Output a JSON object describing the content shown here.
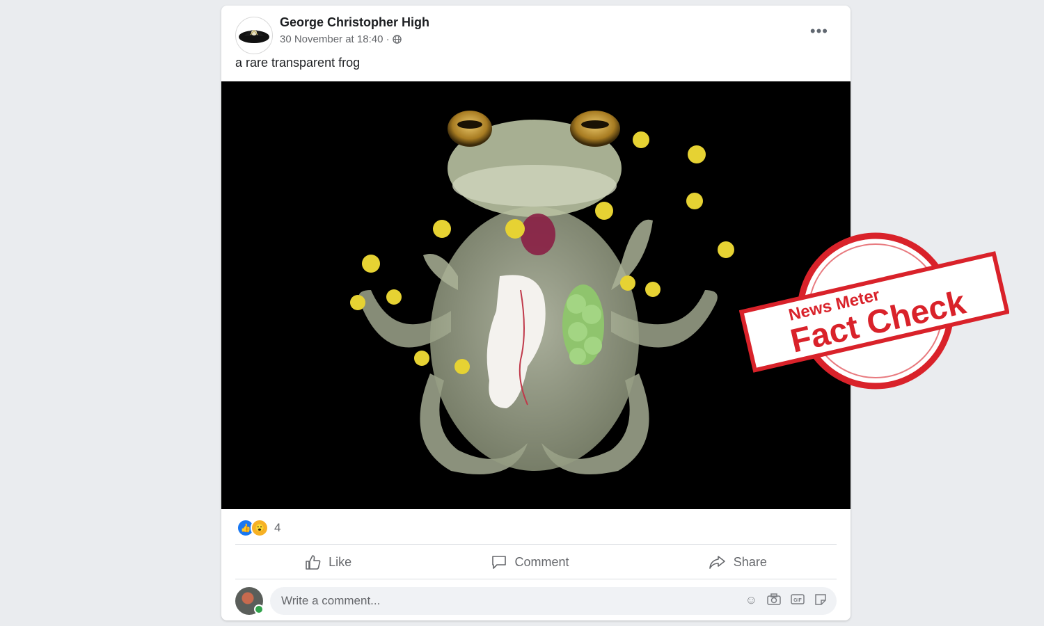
{
  "post": {
    "author": "George Christopher High",
    "timestamp": "30 November at 18:40 ·",
    "privacy_icon": "globe-icon",
    "menu_label": "•••",
    "caption": "a rare transparent frog"
  },
  "reactions": {
    "icons": [
      "like-reaction-icon",
      "wow-reaction-icon"
    ],
    "count": "4"
  },
  "actions": {
    "like": "Like",
    "comment": "Comment",
    "share": "Share"
  },
  "comment_composer": {
    "placeholder": "Write a comment...",
    "tools": [
      "emoji-icon",
      "camera-icon",
      "gif-icon",
      "sticker-icon"
    ]
  },
  "stamp": {
    "brand": "News Meter",
    "label": "Fact Check",
    "color": "#d9222a"
  },
  "colors": {
    "background": "#eaecef",
    "card": "#ffffff",
    "like_blue": "#1877f2",
    "frog_body": "#b9c2a2",
    "frog_toes": "#e6d233"
  }
}
